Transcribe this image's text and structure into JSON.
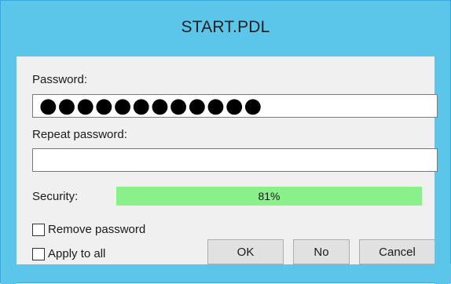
{
  "window": {
    "title": "START.PDL"
  },
  "password": {
    "label": "Password:",
    "value_masked": "●●●●●●●●●●●●"
  },
  "repeat_password": {
    "label": "Repeat password:",
    "value": ""
  },
  "security": {
    "label": "Security:",
    "value_text": "81%",
    "level": 0.81
  },
  "options": {
    "remove_password": {
      "label": "Remove password",
      "checked": false
    },
    "apply_to_all": {
      "label": "Apply to all",
      "checked": false
    }
  },
  "buttons": {
    "ok": "OK",
    "no": "No",
    "cancel": "Cancel"
  },
  "colors": {
    "titlebar": "#5bc5ea",
    "meter_fill": "#8af08a"
  }
}
